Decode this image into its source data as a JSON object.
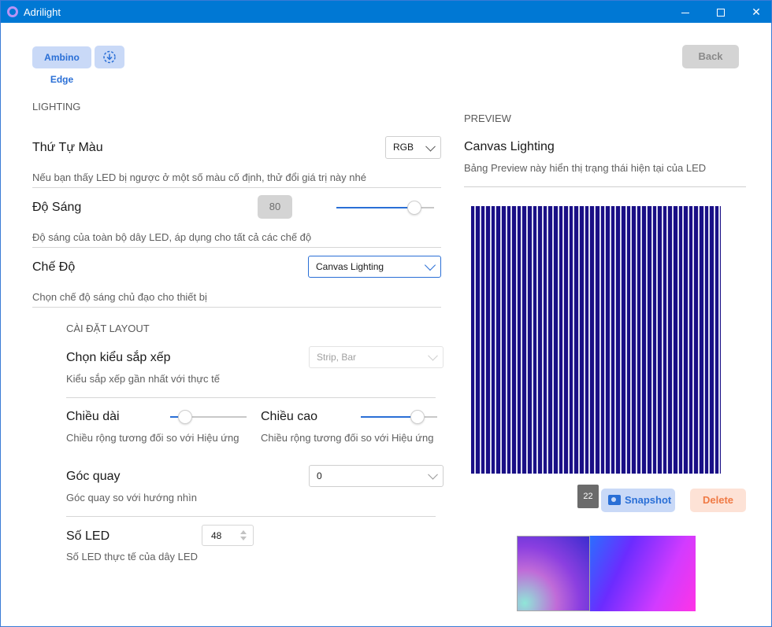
{
  "window": {
    "title": "Adrilight"
  },
  "header": {
    "device_chip": "Ambino Edge",
    "back_label": "Back"
  },
  "lighting": {
    "section_title": "LIGHTING",
    "color_order": {
      "label": "Thứ Tự Màu",
      "value": "RGB",
      "desc": "Nếu bạn thấy LED bị ngược ở một số màu cố định, thử đổi giá trị này nhé"
    },
    "brightness": {
      "label": "Độ Sáng",
      "value": "80",
      "level": 0.8,
      "desc": "Độ sáng của toàn bộ dây LED, áp dụng cho tất cả các chế độ"
    },
    "mode": {
      "label": "Chế Độ",
      "value": "Canvas Lighting",
      "desc": "Chọn chế độ sáng chủ đạo cho thiết bị"
    }
  },
  "layout": {
    "section_title": "CÀI ĐẶT LAYOUT",
    "arrangement": {
      "label": "Chọn kiểu sắp xếp",
      "value": "Strip, Bar",
      "desc": "Kiểu sắp xếp gần nhất với thực tế"
    },
    "length": {
      "label": "Chiều dài",
      "level": 0.2,
      "desc": "Chiều rộng tương đối so với Hiệu ứng"
    },
    "height": {
      "label": "Chiều cao",
      "level": 0.74,
      "desc": "Chiều rộng tương đối so với Hiệu ứng"
    },
    "rotation": {
      "label": "Góc quay",
      "value": "0",
      "desc": "Góc quay so với hướng nhìn"
    },
    "led_count": {
      "label": "Số LED",
      "value": "48",
      "desc": "Số LED thực tế của dây LED"
    }
  },
  "preview": {
    "section_title": "PREVIEW",
    "title": "Canvas Lighting",
    "desc": "Bảng Preview này hiển thị trạng thái hiện tại của LED",
    "led_bars": 48,
    "frame_badge": "22",
    "snapshot_label": "Snapshot",
    "delete_label": "Delete"
  },
  "colors": {
    "accent": "#2a6fd6",
    "titlebar": "#0078d4",
    "canvas_bg": "#1a0f86",
    "delete": "#f07a45"
  },
  "icons": {
    "app": "app-logo-icon",
    "chip": "download-icon",
    "snapshot": "camera-icon"
  }
}
